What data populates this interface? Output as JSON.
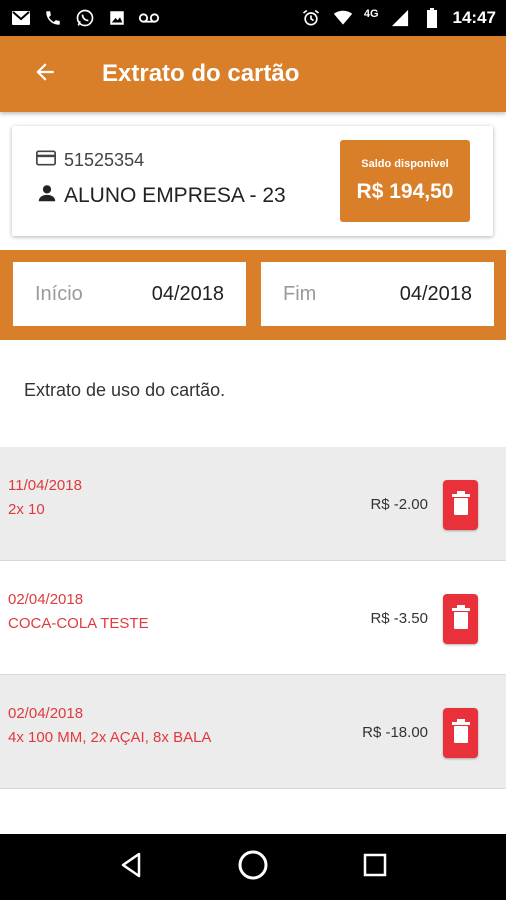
{
  "statusbar": {
    "network": "4G",
    "time": "14:47"
  },
  "appbar": {
    "title": "Extrato do cartão"
  },
  "card": {
    "number": "51525354",
    "holder": "ALUNO EMPRESA - 23",
    "balance_label": "Saldo disponível",
    "balance_value": "R$ 194,50"
  },
  "period": {
    "start_label": "Início",
    "start_value": "04/2018",
    "end_label": "Fim",
    "end_value": "04/2018"
  },
  "intro_text": "Extrato de uso do cartão.",
  "transactions": [
    {
      "date": "11/04/2018",
      "description": "2x 10",
      "amount": "R$ -2.00"
    },
    {
      "date": "02/04/2018",
      "description": "COCA-COLA TESTE",
      "amount": "R$ -3.50"
    },
    {
      "date": "02/04/2018",
      "description": "4x 100 MM, 2x AÇAI, 8x BALA",
      "amount": "R$ -18.00"
    }
  ],
  "colors": {
    "primary": "#d97f2a",
    "danger": "#e8313a",
    "transaction_text": "#e0393e"
  }
}
